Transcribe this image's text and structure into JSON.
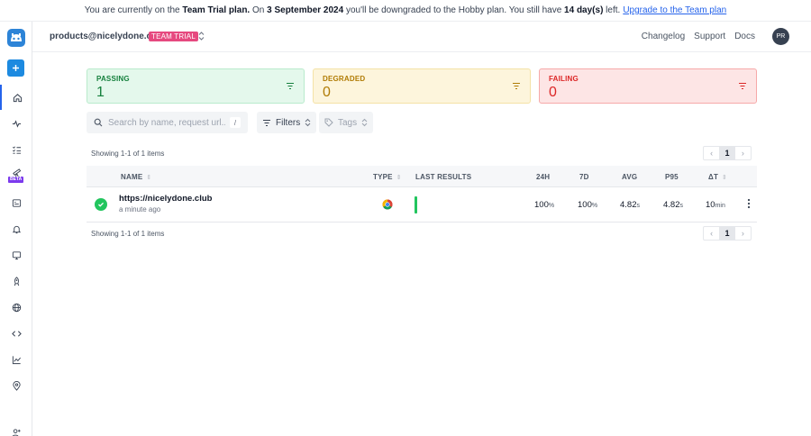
{
  "banner": {
    "t1": "You are currently on the ",
    "plan": "Team Trial plan.",
    "t2": " On ",
    "date": "3 September 2024",
    "t3": " you'll be downgraded to the Hobby plan. You still have ",
    "days": "14 day(s)",
    "t4": " left.",
    "link": "Upgrade to the Team plan"
  },
  "header": {
    "account": "products@nicelydone.cl...",
    "badge": "TEAM TRIAL",
    "links": [
      "Changelog",
      "Support",
      "Docs"
    ],
    "avatar": "PR"
  },
  "sidebar": {
    "beta_label": "BETA",
    "icons": [
      "home-icon",
      "activity-icon",
      "checklist-icon",
      "telescope-icon",
      "dashboard-icon",
      "bell-icon",
      "monitor-icon",
      "rocket-icon",
      "globe-icon",
      "code-icon",
      "chart-icon",
      "location-icon",
      "users-icon"
    ]
  },
  "summary": {
    "passing": {
      "label": "PASSING",
      "count": "1",
      "color": "#15803d"
    },
    "degraded": {
      "label": "DEGRADED",
      "count": "0",
      "color": "#b07b04"
    },
    "failing": {
      "label": "FAILING",
      "count": "0",
      "color": "#dc2626"
    }
  },
  "search": {
    "placeholder": "Search by name, request url...",
    "shortcut": "/"
  },
  "filters": {
    "filters_label": "Filters",
    "tags_label": "Tags"
  },
  "table": {
    "showing": "Showing 1-1 of 1 items",
    "page": "1",
    "columns": [
      "NAME",
      "TYPE",
      "LAST RESULTS",
      "24H",
      "7D",
      "AVG",
      "P95",
      "ΔT"
    ],
    "rows": [
      {
        "name": "https://nicelydone.club",
        "updated": "a minute ago",
        "type_icon": "chrome-icon",
        "h24": "100",
        "h24_unit": "%",
        "d7": "100",
        "d7_unit": "%",
        "avg": "4.82",
        "avg_unit": "s",
        "p95": "4.82",
        "p95_unit": "s",
        "dt": "10",
        "dt_unit": "min"
      }
    ]
  }
}
